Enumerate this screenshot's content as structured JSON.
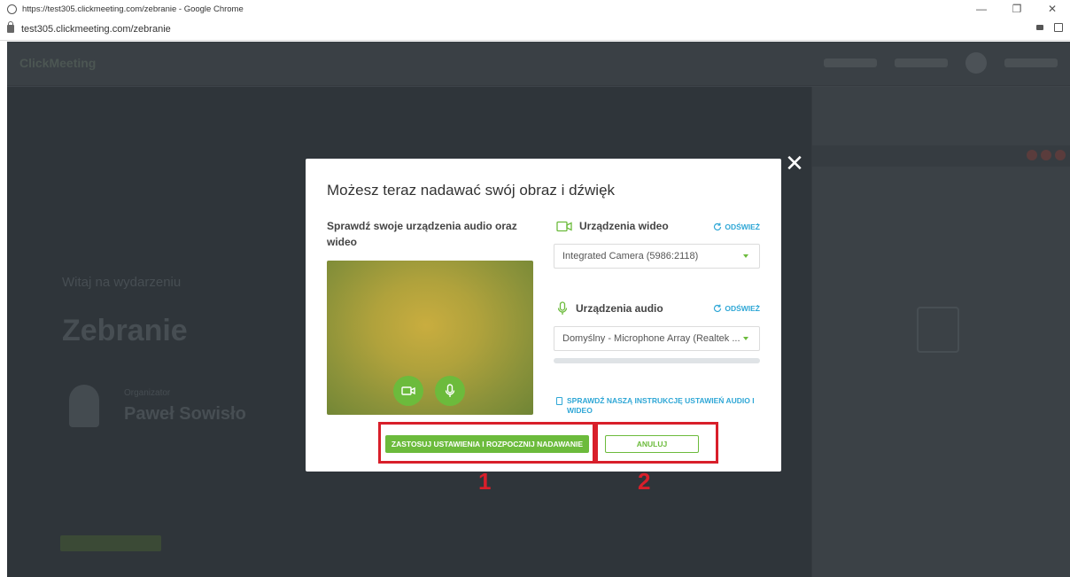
{
  "browser": {
    "window_title": "https://test305.clickmeeting.com/zebranie - Google Chrome",
    "address": "test305.clickmeeting.com/zebranie",
    "controls": {
      "minimize": "—",
      "restore": "❐",
      "close": "✕"
    }
  },
  "app_background": {
    "logo": "ClickMeeting",
    "welcome": "Witaj na wydarzeniu",
    "event_name": "Zebranie",
    "organizer_label": "Organizator",
    "organizer_name": "Paweł Sowisło"
  },
  "modal": {
    "close_glyph": "✕",
    "title": "Możesz teraz nadawać swój obraz i dźwięk",
    "check_devices_text": "Sprawdź swoje urządzenia audio oraz wideo",
    "video_section_label": "Urządzenia wideo",
    "audio_section_label": "Urządzenia audio",
    "refresh_label": "ODŚWIEŻ",
    "video_device": "Integrated Camera (5986:2118)",
    "audio_device": "Domyślny - Microphone Array (Realtek ...",
    "instructions_link": "SPRAWDŹ NASZĄ INSTRUKCJĘ USTAWIEŃ AUDIO I WIDEO",
    "apply_button": "ZASTOSUJ USTAWIENIA I ROZPOCZNIJ NADAWANIE",
    "cancel_button": "ANULUJ"
  },
  "annotations": {
    "label_1": "1",
    "label_2": "2"
  },
  "colors": {
    "accent_green": "#6cbb3c",
    "link_blue": "#2fa7d6",
    "annotation_red": "#d81f2a"
  },
  "icons": [
    "chrome-favicon",
    "lock-icon",
    "close-icon",
    "video-camera-icon",
    "microphone-icon",
    "refresh-icon",
    "document-icon",
    "chevron-down-icon"
  ]
}
